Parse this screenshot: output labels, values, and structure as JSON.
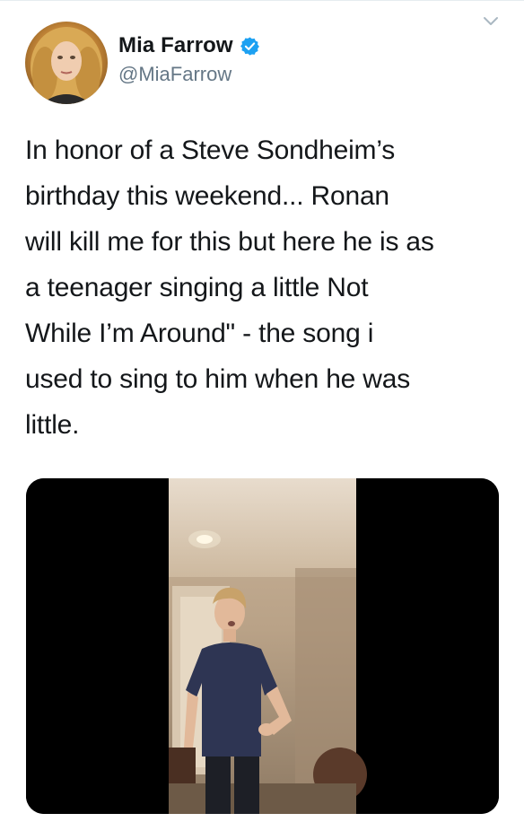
{
  "tweet": {
    "author": {
      "display_name": "Mia Farrow",
      "handle": "@MiaFarrow",
      "verified": true,
      "avatar_icon": "profile-photo",
      "verified_icon": "verified-badge-icon"
    },
    "text_lines": [
      "In honor of a Steve Sondheim’s",
      "birthday this weekend... Ronan",
      "will kill me for this but here he is as",
      "a teenager singing a little Not",
      "While I’m Around\" - the song i",
      "used to sing to him when he was",
      "little."
    ],
    "media": {
      "type": "video",
      "description_icon": "video-thumbnail"
    },
    "menu_icon": "chevron-down-icon"
  },
  "colors": {
    "text": "#14171a",
    "secondary": "#657786",
    "verified_blue": "#1da1f2",
    "divider": "#e6ecf0"
  }
}
